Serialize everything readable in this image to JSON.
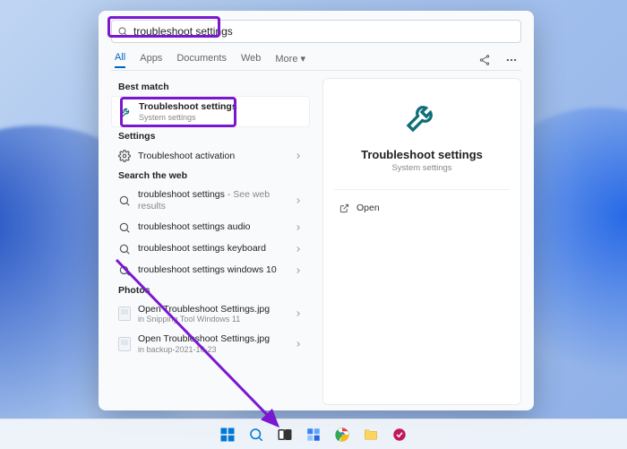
{
  "search": {
    "query": "troubleshoot settings"
  },
  "tabs": {
    "all": "All",
    "apps": "Apps",
    "documents": "Documents",
    "web": "Web",
    "more": "More"
  },
  "sections": {
    "best_match": "Best match",
    "settings": "Settings",
    "search_web": "Search the web",
    "photos": "Photos"
  },
  "best_match": {
    "title": "Troubleshoot settings",
    "subtitle": "System settings"
  },
  "settings_items": [
    {
      "label": "Troubleshoot activation"
    }
  ],
  "web_items": [
    {
      "label": "troubleshoot settings",
      "suffix": " - See web results"
    },
    {
      "label": "troubleshoot settings audio",
      "suffix": ""
    },
    {
      "label": "troubleshoot settings keyboard",
      "suffix": ""
    },
    {
      "label": "troubleshoot settings windows 10",
      "suffix": ""
    }
  ],
  "photos_items": [
    {
      "title": "Open Troubleshoot Settings.jpg",
      "sub": "in Snipping Tool Windows 11"
    },
    {
      "title": "Open Troubleshoot Settings.jpg",
      "sub": "in backup-2021-10-23"
    }
  ],
  "preview": {
    "title": "Troubleshoot settings",
    "subtitle": "System settings",
    "open": "Open"
  },
  "colors": {
    "accent": "#0067c0",
    "annotation": "#7a17d1",
    "wrench": "#0f6e78"
  }
}
